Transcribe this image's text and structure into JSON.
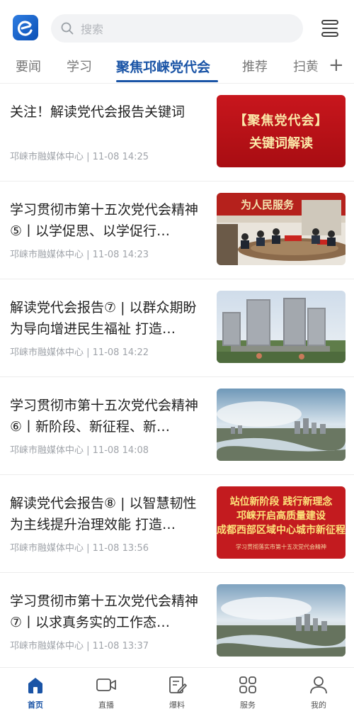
{
  "header": {
    "logo_icon": "app-logo-icon",
    "search_placeholder": "搜索",
    "menu_icon": "menu-icon"
  },
  "tabs": [
    {
      "label": "要闻",
      "active": false
    },
    {
      "label": "学习",
      "active": false
    },
    {
      "label": "聚焦邛崃党代会",
      "active": true
    },
    {
      "label": "推荐",
      "active": false
    },
    {
      "label": "扫黄",
      "active": false
    }
  ],
  "tabs_add_label": "+",
  "accent_color": "#1a54a6",
  "news": [
    {
      "title": "关注！解读党代会报告关键词",
      "source": "邛崃市融媒体中心",
      "time": "11-08 14:25",
      "thumb": {
        "line1": "【聚焦党代会】",
        "line2": "关键词解读"
      }
    },
    {
      "title": "学习贯彻市第十五次党代会精神⑤丨以学促思、以学促行…",
      "source": "邛崃市融媒体中心",
      "time": "11-08 14:23",
      "thumb": {
        "banner": "为人民服务"
      }
    },
    {
      "title": "解读党代会报告⑦ | 以群众期盼为导向增进民生福祉 打造…",
      "source": "邛崃市融媒体中心",
      "time": "11-08 14:22"
    },
    {
      "title": "学习贯彻市第十五次党代会精神⑥丨新阶段、新征程、新…",
      "source": "邛崃市融媒体中心",
      "time": "11-08 14:08"
    },
    {
      "title": "解读党代会报告⑧ | 以智慧韧性为主线提升治理效能 打造…",
      "source": "邛崃市融媒体中心",
      "time": "11-08 13:56",
      "thumb": {
        "line1": "站位新阶段 践行新理念",
        "line2": "邛崃开启高质量建设",
        "line3": "成都西部区域中心城市新征程",
        "caption": "学习贯彻落实市第十五次党代会精神"
      }
    },
    {
      "title": "学习贯彻市第十五次党代会精神⑦丨以求真务实的工作态…",
      "source": "邛崃市融媒体中心",
      "time": "11-08 13:37"
    }
  ],
  "bottom_nav": [
    {
      "label": "首页",
      "icon": "home-icon",
      "active": true
    },
    {
      "label": "直播",
      "icon": "video-icon",
      "active": false
    },
    {
      "label": "爆料",
      "icon": "edit-icon",
      "active": false
    },
    {
      "label": "服务",
      "icon": "grid-icon",
      "active": false
    },
    {
      "label": "我的",
      "icon": "user-icon",
      "active": false
    }
  ]
}
